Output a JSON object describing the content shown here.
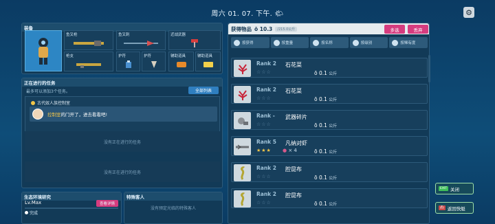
{
  "topbar": {
    "date": "周六 01. 07. 下午. 🌤"
  },
  "equipment": {
    "title": "装备",
    "slots": [
      {
        "label": "鱼叉枪"
      },
      {
        "label": "鱼叉刺"
      },
      {
        "label": "近战武器"
      },
      {
        "label": "枪支"
      },
      {
        "label": "护符"
      },
      {
        "label": "护符"
      },
      {
        "label": "辅助道具"
      },
      {
        "label": "辅助道具"
      }
    ]
  },
  "tasks": {
    "title": "正在进行的任务",
    "subtitle": "最多可以添加3个任务。",
    "all_list_label": "全部列表",
    "card_title": "古代奴人族控制室",
    "message_highlight": "控制室",
    "message_rest": "的门开了，进去看看吧!",
    "empty1": "没有正在进行的任务",
    "empty2": "没有正在进行的任务"
  },
  "research": {
    "title": "生态环境研究",
    "level": "Lv.Max",
    "button": "查看详情",
    "status": "完成"
  },
  "special": {
    "title": "特殊客人",
    "empty": "没有预定光临的特殊客人"
  },
  "inventory": {
    "title": "获得物品",
    "weight": "ō 10.3",
    "capacity": "/215.0公斤",
    "multi_select": "多选",
    "discard": "丢弃",
    "sorts": [
      {
        "label": "按获得"
      },
      {
        "label": "按重量"
      },
      {
        "label": "按名称"
      },
      {
        "label": "按级别"
      },
      {
        "label": "按稀有度"
      }
    ],
    "items": [
      {
        "rank": "Rank 2",
        "name": "石花菜",
        "weight": "ō 0.1",
        "unit": "公斤",
        "stars": "☆☆☆"
      },
      {
        "rank": "Rank 2",
        "name": "石花菜",
        "weight": "ō 0.1",
        "unit": "公斤",
        "stars": "☆☆☆"
      },
      {
        "rank": "Rank -",
        "name": "武器碎片",
        "weight": "ō 0.1",
        "unit": "公斤",
        "stars": "☆☆☆"
      },
      {
        "rank": "Rank 5",
        "name": "凡纳对虾",
        "weight": "ō 0.1",
        "unit": "公斤",
        "stars": "★★★",
        "extra": "× 4"
      },
      {
        "rank": "Rank 2",
        "name": "腔昆布",
        "weight": "ō 0.1",
        "unit": "公斤",
        "stars": "☆☆☆"
      },
      {
        "rank": "Rank 2",
        "name": "腔昆布",
        "weight": "ō 0.1",
        "unit": "公斤",
        "stars": "☆☆☆"
      }
    ]
  },
  "right_buttons": {
    "close_tag": "EXIT",
    "close_label": "关闭",
    "ship_label": "返回快艇"
  }
}
